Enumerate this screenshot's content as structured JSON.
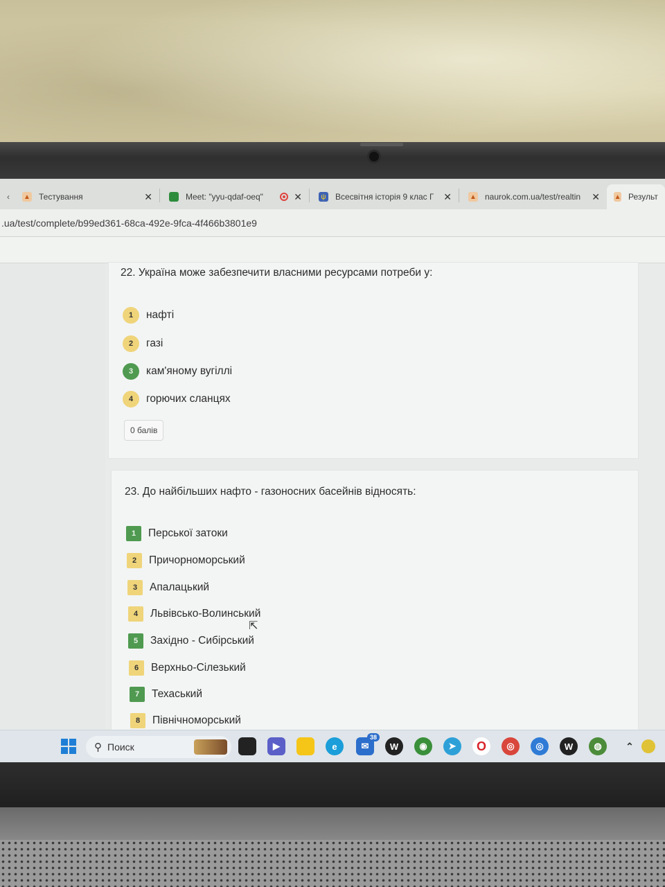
{
  "browser": {
    "tabs": [
      {
        "title": "Тестування"
      },
      {
        "title": "Meet: \"yyu-qdaf-oeq\""
      },
      {
        "title": "Всесвітня історія 9 клас Г"
      },
      {
        "title": "naurok.com.ua/test/realtin"
      },
      {
        "title": "Результат"
      }
    ],
    "url": ".ua/test/complete/b99ed361-68ca-492e-9fca-4f466b3801e9",
    "close_glyph": "✕"
  },
  "questions": [
    {
      "title": "22. Україна може забезпечити власними ресурсами потреби у:",
      "answers": [
        {
          "num": "1",
          "text": "нафті",
          "state": "yellow"
        },
        {
          "num": "2",
          "text": "газі",
          "state": "yellow"
        },
        {
          "num": "3",
          "text": "кам'яному вугіллі",
          "state": "green"
        },
        {
          "num": "4",
          "text": "горючих сланцях",
          "state": "yellow"
        }
      ],
      "score": "0 балів"
    },
    {
      "title": "23. До найбільших нафто - газоносних басейнів відносять:",
      "answers": [
        {
          "num": "1",
          "text": "Перської затоки",
          "state": "green"
        },
        {
          "num": "2",
          "text": "Причорноморський",
          "state": "yellow"
        },
        {
          "num": "3",
          "text": "Апалацький",
          "state": "yellow"
        },
        {
          "num": "4",
          "text": "Львівсько-Волинський",
          "state": "yellow"
        },
        {
          "num": "5",
          "text": "Західно - Сибірський",
          "state": "green"
        },
        {
          "num": "6",
          "text": "Верхньо-Сілезький",
          "state": "yellow"
        },
        {
          "num": "7",
          "text": "Техаський",
          "state": "green"
        },
        {
          "num": "8",
          "text": "Північноморський",
          "state": "yellow"
        }
      ]
    }
  ],
  "taskbar": {
    "search_placeholder": "Поиск",
    "mail_badge": "38"
  },
  "colors": {
    "correct": "#4f9a50",
    "neutral": "#efd47a"
  }
}
